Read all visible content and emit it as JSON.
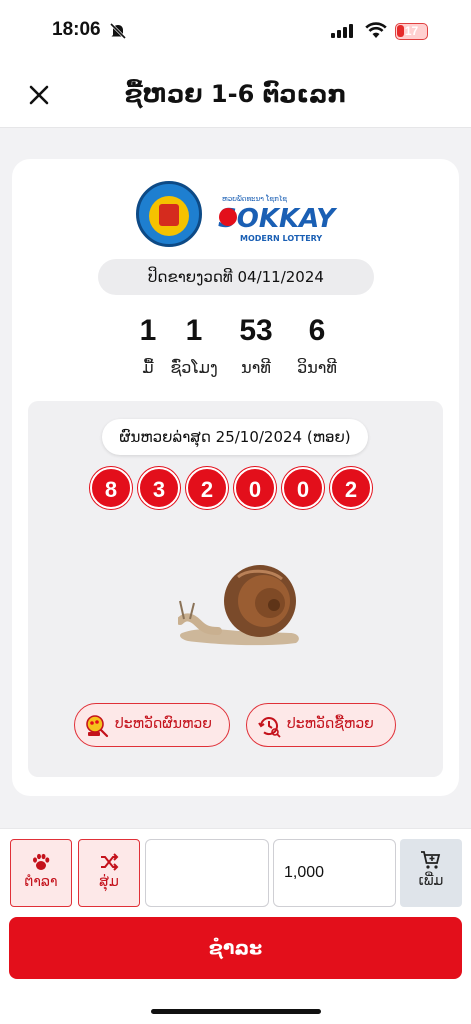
{
  "status_bar": {
    "time": "18:06",
    "battery": "17"
  },
  "header": {
    "title": "ຊື້ຫວຍ 1-6 ຕົວເລກ",
    "close_icon": "close-icon"
  },
  "card": {
    "closing_label": "ປິດຂາຍງວດທີ 04/11/2024",
    "countdown": [
      {
        "value": "1",
        "unit": "ມື້"
      },
      {
        "value": "1",
        "unit": "ຊົ່ວໂມງ"
      },
      {
        "value": "53",
        "unit": "ນາທີ"
      },
      {
        "value": "6",
        "unit": "ວິນາທີ"
      }
    ],
    "latest_result_label": "ຜົນຫວຍລ່າສຸດ 25/10/2024 (ຫອຍ)",
    "latest_numbers": [
      "8",
      "3",
      "2",
      "0",
      "0",
      "2"
    ],
    "history_results_label": "ປະຫວັດຜົນຫວຍ",
    "history_purchases_label": "ປະຫວັດຊື້ຫວຍ",
    "colors": {
      "accent": "#e30f1b",
      "accent_light": "#fde8e8"
    }
  },
  "bottom_bar": {
    "tool1_label": "ຕຳລາ",
    "tool2_label": "ສຸ່ມ",
    "number_input_value": "",
    "amount_value": "1,000",
    "add_label": "ເພີ່ມ",
    "pay_label": "ຊຳລະ"
  }
}
